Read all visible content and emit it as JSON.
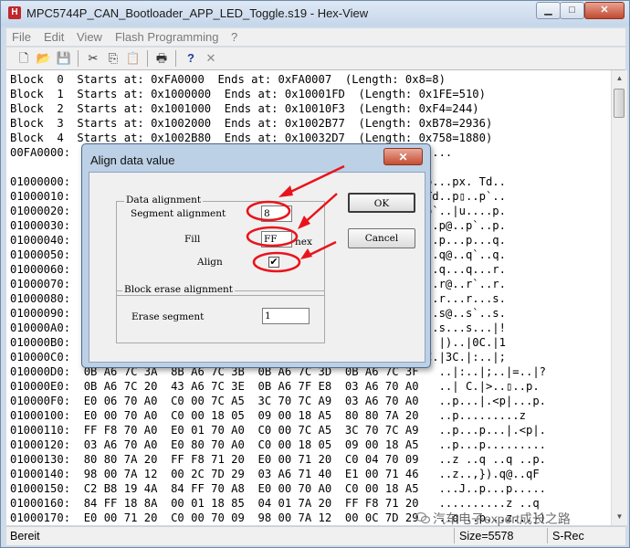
{
  "window": {
    "title": "MPC5744P_CAN_Bootloader_APP_LED_Toggle.s19 - Hex-View",
    "icon_letter": "H",
    "min_glyph": "▁",
    "max_glyph": "□",
    "close_glyph": "✕"
  },
  "menu": [
    "File",
    "Edit",
    "View",
    "Flash Programming",
    "?"
  ],
  "toolbar": [
    {
      "name": "new-file-icon",
      "glyph": "🗋"
    },
    {
      "name": "open-folder-icon",
      "glyph": "📂"
    },
    {
      "name": "save-icon",
      "glyph": "💾"
    },
    {
      "name": "cut-icon",
      "glyph": "✂"
    },
    {
      "name": "copy-icon",
      "glyph": "⎘"
    },
    {
      "name": "paste-icon",
      "glyph": "📋"
    },
    {
      "name": "print-icon",
      "glyph": "🖶"
    },
    {
      "name": "help-icon",
      "glyph": "?"
    },
    {
      "name": "close-x-icon",
      "glyph": "✕"
    }
  ],
  "hex_lines": [
    "Block  0  Starts at: 0xFA0000  Ends at: 0xFA0007  (Length: 0x8=8)",
    "Block  1  Starts at: 0x1000000  Ends at: 0x10001FD  (Length: 0x1FE=510)",
    "Block  2  Starts at: 0x1001000  Ends at: 0x10010F3  (Length: 0xF4=244)",
    "Block  3  Starts at: 0x1002000  Ends at: 0x1002B77  (Length: 0xB78=2936)",
    "Block  4  Starts at: 0x1002B80  Ends at: 0x10032D7  (Length: 0x758=1880)",
    "00FA0000:                                                 .Z......",
    "",
    "01000000:                                         0  10   p...p...px. Td..",
    "01000010:                                         1  0A   p{.(Td..p▯..p`..",
    "01000020:                                         0  00   Td..p`..|u....p.",
    "01000030:                                         0  80   ..p ..p@..p`..p.",
    "01000040:                                         0  80   ..p...p...p...q.",
    "01000050:                                         0  80   ..q ..q@..q`..q.",
    "01000060:                                         0  80   ..q...q...q...r.",
    "01000070:                                         0  80   ..r ..r@..r`..r.",
    "01000080:                                         0  80   ..r...r...r...s.",
    "01000090:                                         0  80   ..s ..s@..s`..s.",
    "010000A0:                                         C  21   ..s...s...s...|!",
    "010000B0:                                         C  31   ..|/. |)..|0C.|1",
    "010000C0:                                         C  3B   C.|2C.|3C.|:..|;",
    "010000D0:  0B A6 7C 3A  8B A6 7C 3B  0B A6 7C 3D  0B A6 7C 3F   ..|:..|;..|=..|?",
    "010000E0:  0B A6 7C 20  43 A6 7C 3E  0B A6 7F E8  03 A6 70 A0   ..| C.|>..▯..p.",
    "010000F0:  E0 06 70 A0  C0 00 7C A5  3C 70 7C A9  03 A6 70 A0   ..p...|.<p|...p.",
    "01000100:  E0 00 70 A0  C0 00 18 05  09 00 18 A5  80 80 7A 20   ..p.........z ",
    "01000110:  FF F8 70 A0  E0 01 70 A0  C0 00 7C A5  3C 70 7C A9   ..p...p...|.<p|.",
    "01000120:  03 A6 70 A0  E0 80 70 A0  C0 00 18 05  09 00 18 A5   ..p...p.........",
    "01000130:  80 80 7A 20  FF F8 71 20  E0 00 71 20  C0 04 70 09   ..z ..q ..q ..p.",
    "01000140:  98 00 7A 12  00 2C 7D 29  03 A6 71 40  E1 00 71 46   ..z..,}).q@..qF",
    "01000150:  C2 B8 19 4A  84 FF 70 A8  E0 00 70 A0  C0 00 18 A5   ...J..p...p.....",
    "01000160:  84 FF 18 8A  00 01 18 85  04 01 7A 20  FF F8 71 20   ..........z ..q ",
    "01000170:  E0 00 71 20  C0 00 70 09  98 00 7A 12  00 0C 7D 29   ..q ..p...z...})"
  ],
  "status": {
    "ready": "Bereit",
    "size": "Size=5578",
    "format": "S-Rec"
  },
  "dialog": {
    "title": "Align data value",
    "close_glyph": "✕",
    "data_alignment_legend": "Data alignment",
    "segment_alignment_label": "Segment alignment",
    "segment_alignment_value": "8",
    "fill_label": "Fill",
    "fill_value": "FF",
    "hex_label": "hex",
    "align_label": "Align",
    "align_checked": true,
    "check_glyph": "✔",
    "block_erase_legend": "Block erase alignment",
    "erase_segment_label": "Erase segment",
    "erase_segment_value": "1",
    "ok_label": "OK",
    "cancel_label": "Cancel"
  },
  "watermark": "汽车电子expert成长之路",
  "colors": {
    "annotation_red": "#e8141b",
    "title_bar": "#c5d6ea",
    "dialog_frame": "#bcd0e6",
    "close_red": "#c24a30"
  }
}
